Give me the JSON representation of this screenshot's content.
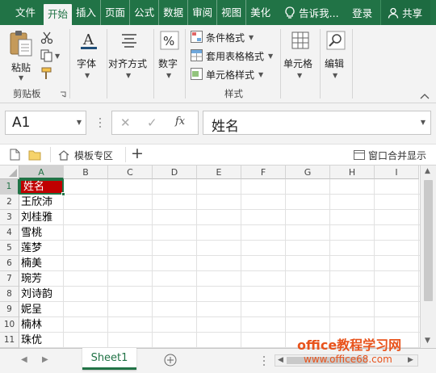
{
  "tabs": {
    "file": "文件",
    "home": "开始",
    "insert": "插入",
    "page_layout": "页面",
    "formulas": "公式",
    "data": "数据",
    "review": "审阅",
    "view": "视图",
    "beautify": "美化",
    "tell_me": "告诉我...",
    "login": "登录",
    "share": "共享"
  },
  "ribbon": {
    "paste": "粘贴",
    "clipboard_group": "剪贴板",
    "font": "字体",
    "alignment": "对齐方式",
    "number": "数字",
    "conditional_format": "条件格式",
    "table_format": "套用表格格式",
    "cell_style": "单元格样式",
    "styles_group": "样式",
    "cells": "单元格",
    "editing": "编辑"
  },
  "formula_bar": {
    "name_box": "A1",
    "fx": "fx",
    "formula": "姓名"
  },
  "workbook_strip": {
    "template_zone": "模板专区",
    "window_merge": "窗口合并显示"
  },
  "grid": {
    "columns": [
      "A",
      "B",
      "C",
      "D",
      "E",
      "F",
      "G",
      "H",
      "I"
    ],
    "rows": [
      "1",
      "2",
      "3",
      "4",
      "5",
      "6",
      "7",
      "8",
      "9",
      "10",
      "11"
    ],
    "column_a_values": [
      "姓名",
      "王欣沛",
      "刘桂雅",
      "雪桃",
      "莲梦",
      "楠美",
      "琬芳",
      "刘诗韵",
      "妮呈",
      "楠林",
      "珠优"
    ]
  },
  "sheets": {
    "active": "Sheet1"
  },
  "watermark": {
    "line1": "office教程学习网",
    "line2": "www.office68.com"
  },
  "colors": {
    "brand_green": "#217346",
    "header_cell_fill": "#c00000"
  }
}
